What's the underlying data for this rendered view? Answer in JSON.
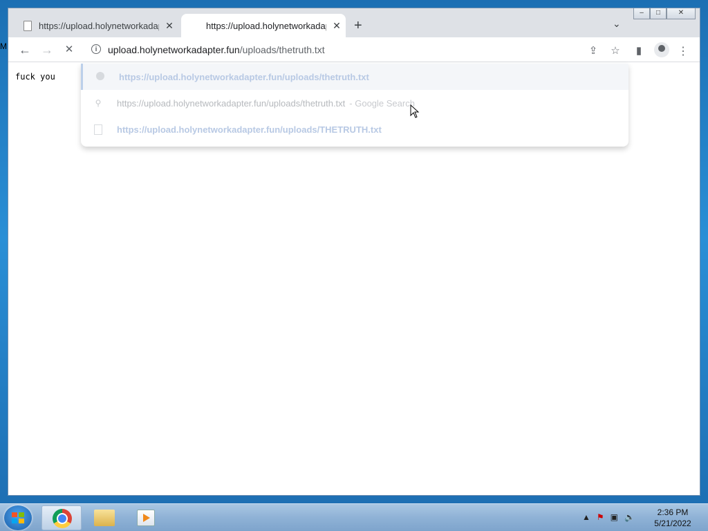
{
  "desktop": {
    "edge_text": "M"
  },
  "browser": {
    "tabs": [
      {
        "title": "https://upload.holynetworkadapter.fun/uploads/thetruth.txt",
        "active": false
      },
      {
        "title": "https://upload.holynetworkadapter.fun/uploads/thetruth.txt",
        "active": true
      }
    ],
    "icons": {
      "new_tab": "+",
      "tab_search": "⌄",
      "back": "←",
      "forward": "→",
      "stop": "✕",
      "close": "✕"
    },
    "omnibox": {
      "host": "upload.holynetworkadapter.fun",
      "path": "/uploads/thetruth.txt"
    },
    "suggestions": [
      {
        "text": "https://upload.holynetworkadapter.fun/uploads/thetruth.txt",
        "icon": "globe-icon"
      },
      {
        "text": "https://upload.holynetworkadapter.fun/uploads/thetruth.txt",
        "suffix": "- Google Search",
        "icon": "search-icon"
      },
      {
        "text": "https://upload.holynetworkadapter.fun/uploads/THETRUTH.txt",
        "icon": "document-icon"
      }
    ],
    "page": {
      "content": "fuck you"
    }
  },
  "taskbar": {
    "clock_time": "2:36 PM",
    "clock_date": "5/21/2022",
    "tray_icons": [
      "show-hidden-icons",
      "action-center-icon",
      "network-icon",
      "volume-icon"
    ]
  }
}
